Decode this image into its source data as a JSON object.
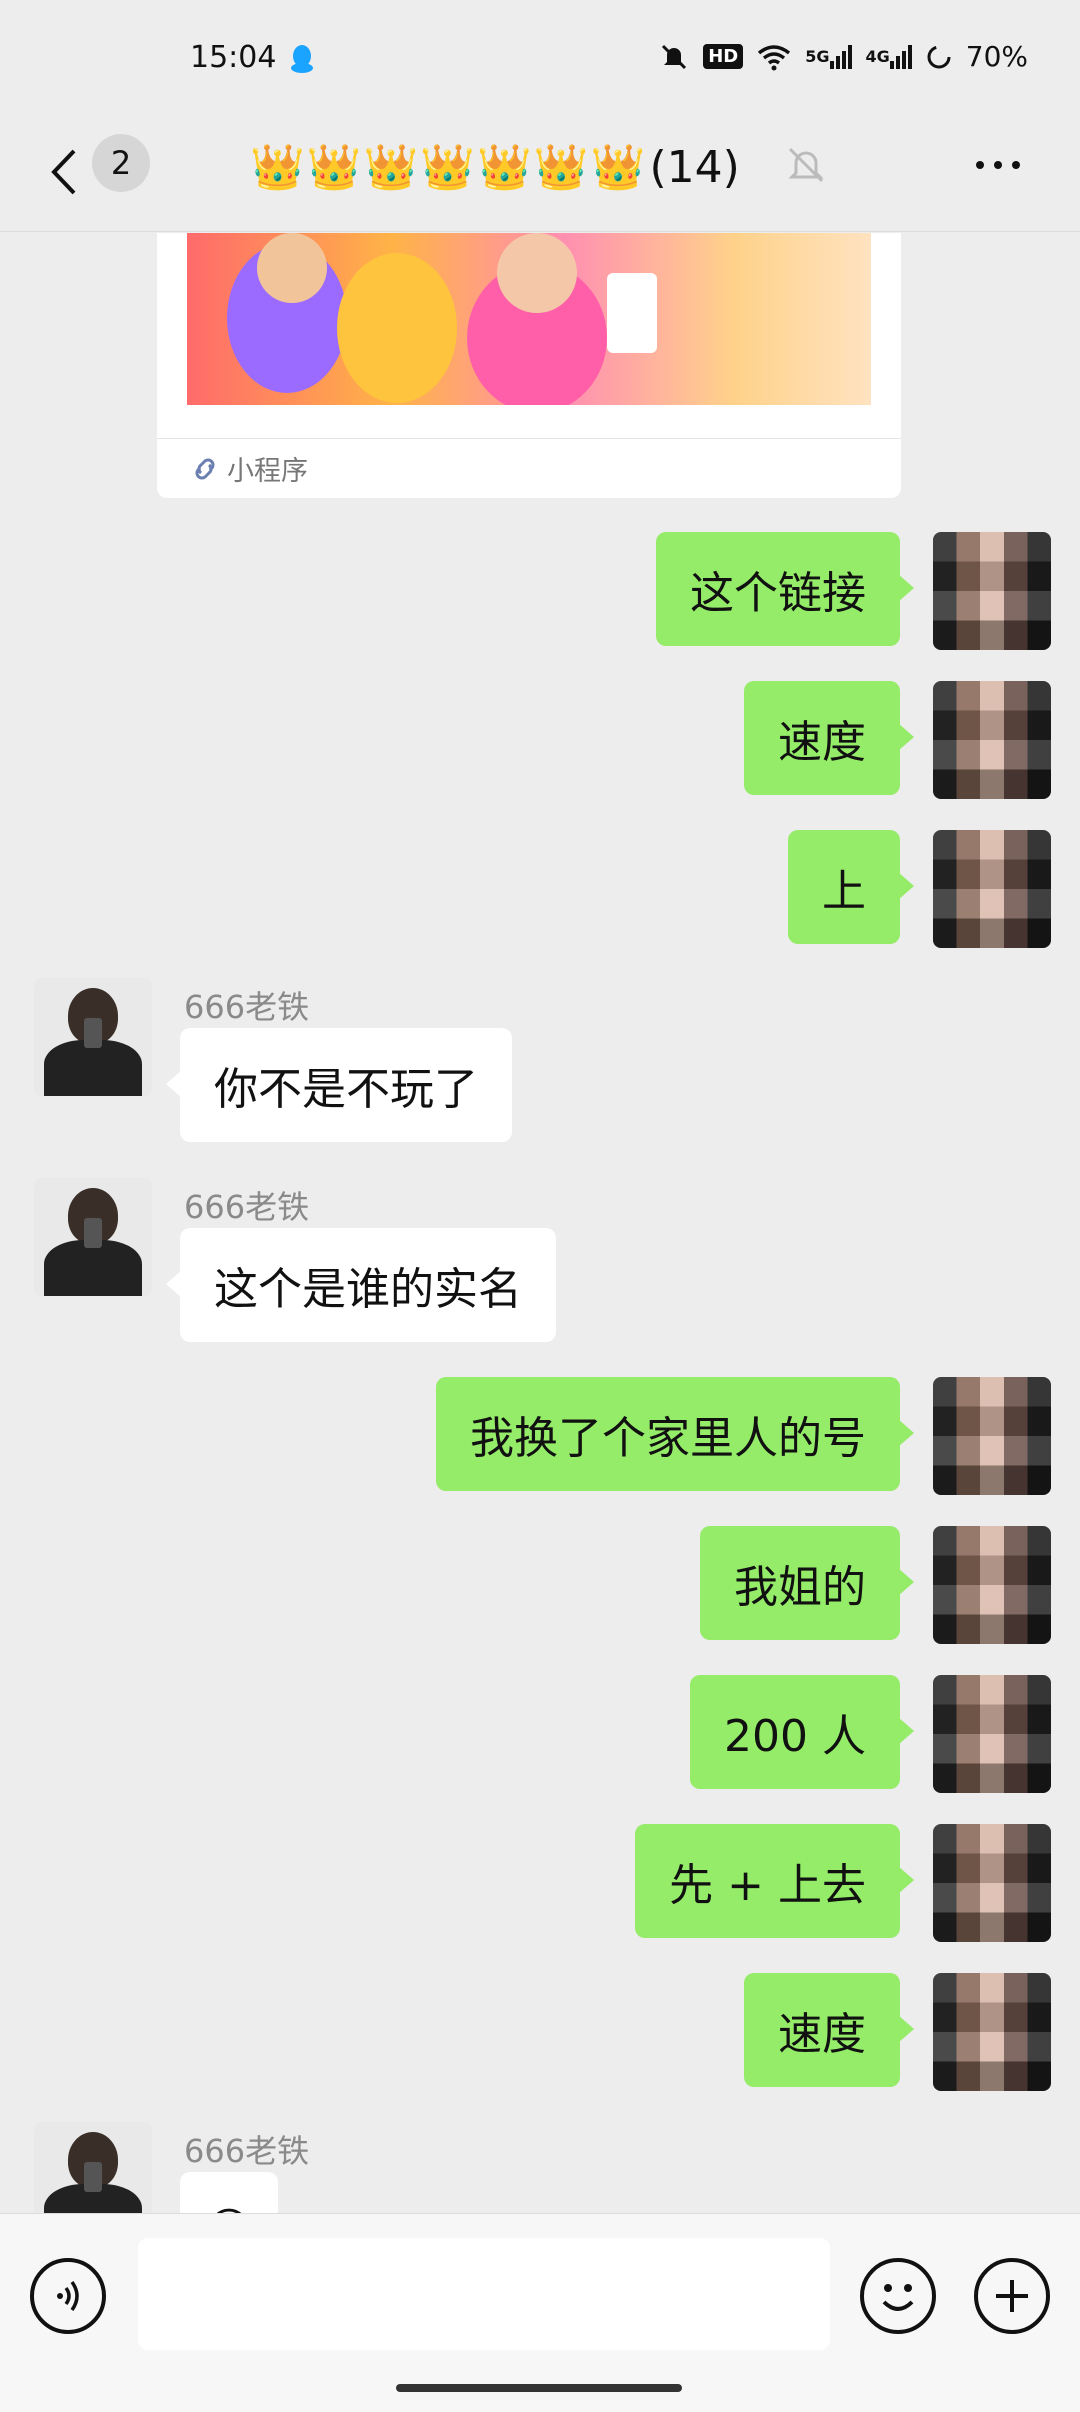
{
  "status_bar": {
    "time": "15:04",
    "battery": "70%",
    "hd_label": "HD",
    "signal_5g": "5G",
    "signal_4g": "4G"
  },
  "header": {
    "unread_count": "2",
    "title_crowns": "👑👑👑👑👑👑👑",
    "title_count": "(14)"
  },
  "mini_program": {
    "label": "小程序"
  },
  "messages": [
    {
      "side": "me",
      "text": "这个链接"
    },
    {
      "side": "me",
      "text": "速度"
    },
    {
      "side": "me",
      "text": "上"
    },
    {
      "side": "them",
      "sender": "666老铁",
      "text": "你不是不玩了"
    },
    {
      "side": "them",
      "sender": "666老铁",
      "text": "这个是谁的实名"
    },
    {
      "side": "me",
      "text": "我换了个家里人的号"
    },
    {
      "side": "me",
      "text": "我姐的"
    },
    {
      "side": "me",
      "text": "200 人"
    },
    {
      "side": "me",
      "text": "先 + 上去"
    },
    {
      "side": "me",
      "text": "速度"
    },
    {
      "side": "them",
      "sender": "666老铁",
      "text": "😊"
    }
  ],
  "input": {
    "placeholder": ""
  },
  "colors": {
    "my_bubble": "#95ec69",
    "their_bubble": "#ffffff",
    "background": "#ededed"
  }
}
